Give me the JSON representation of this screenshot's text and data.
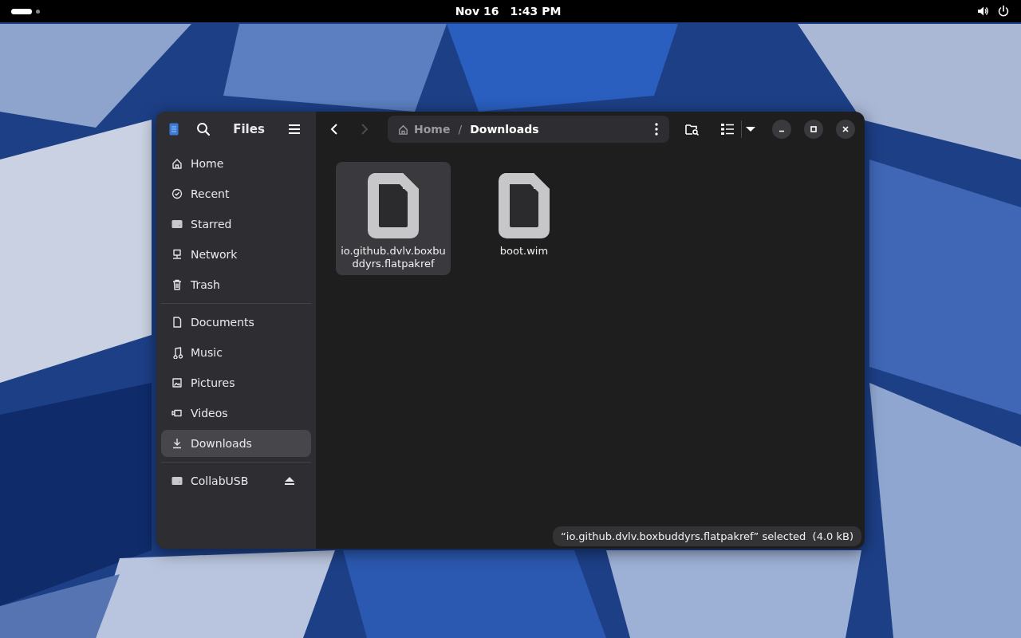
{
  "top_bar": {
    "date": "Nov 16",
    "time": "1:43 PM"
  },
  "window": {
    "title": "Files",
    "back_disabled": false,
    "forward_disabled": true
  },
  "path_bar": {
    "segments": [
      {
        "label": "Home",
        "kind": "home"
      },
      {
        "label": "Downloads",
        "kind": "folder"
      }
    ],
    "separator": "/"
  },
  "sidebar": {
    "sections": [
      [
        {
          "label": "Home",
          "selected": false
        },
        {
          "label": "Recent",
          "selected": false
        },
        {
          "label": "Starred",
          "selected": false
        },
        {
          "label": "Network",
          "selected": false
        },
        {
          "label": "Trash",
          "selected": false
        }
      ],
      [
        {
          "label": "Documents",
          "selected": false
        },
        {
          "label": "Music",
          "selected": false
        },
        {
          "label": "Pictures",
          "selected": false
        },
        {
          "label": "Videos",
          "selected": false
        },
        {
          "label": "Downloads",
          "selected": true
        }
      ],
      [
        {
          "label": "CollabUSB",
          "selected": false,
          "ejectable": true
        }
      ]
    ]
  },
  "files": [
    {
      "name": "io.github.dvlv.boxbuddyrs.flatpakref",
      "selected": true
    },
    {
      "name": "boot.wim",
      "selected": false
    }
  ],
  "status": "“io.github.dvlv.boxbuddyrs.flatpakref” selected  (4.0 kB)"
}
